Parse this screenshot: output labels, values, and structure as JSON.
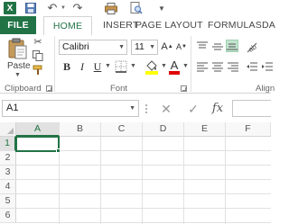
{
  "app": {
    "logo_letter": "X",
    "icons": [
      "excel-logo-icon",
      "save-icon",
      "undo-icon",
      "redo-icon",
      "print-icon",
      "print-preview-icon",
      "customize-qat-icon"
    ]
  },
  "tabs": {
    "file": "FILE",
    "home": "HOME",
    "insert": "INSERT",
    "page_layout": "PAGE LAYOUT",
    "formulas": "FORMULAS",
    "data": "DA"
  },
  "ribbon": {
    "clipboard": {
      "paste_label": "Paste",
      "group_label": "Clipboard"
    },
    "font": {
      "font_name": "Calibri",
      "font_size": "11",
      "bold": "B",
      "italic": "I",
      "underline": "U",
      "font_color_letter": "A",
      "fill_color": "#ffff00",
      "font_color": "#e00000",
      "group_label": "Font"
    },
    "alignment": {
      "group_label": "Align"
    }
  },
  "formula_bar": {
    "name_box": "A1",
    "fx_label": "fx",
    "value": ""
  },
  "sheet": {
    "columns": [
      "A",
      "B",
      "C",
      "D",
      "E",
      "F"
    ],
    "rows": [
      "1",
      "2",
      "3",
      "4",
      "5",
      "6"
    ],
    "active_cell": "A1"
  },
  "colors": {
    "accent": "#217346",
    "selection": "#c3e4cf"
  }
}
